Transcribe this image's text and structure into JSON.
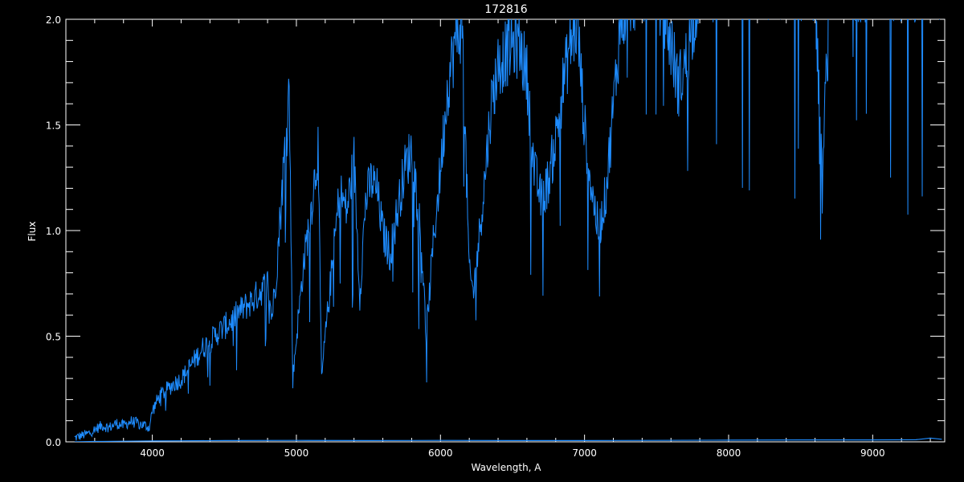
{
  "chart_data": {
    "type": "line",
    "title": "172816",
    "xlabel": "Wavelength, A",
    "ylabel": "Flux",
    "xlim": [
      3400,
      9500
    ],
    "ylim": [
      0.0,
      2.0
    ],
    "x_ticks": [
      "4000",
      "5000",
      "6000",
      "7000",
      "8000",
      "9000"
    ],
    "y_ticks": [
      "0.0",
      "0.5",
      "1.0",
      "1.5",
      "2.0"
    ],
    "grid": false,
    "colors": {
      "background": "#000000",
      "axes": "#ffffff",
      "spectrum": "#1e8cff",
      "error": "#1e8cff"
    },
    "series": [
      {
        "x": [
          3460,
          3500,
          3550,
          3600,
          3650,
          3700,
          3750,
          3800,
          3850,
          3900,
          3950,
          3980,
          4000,
          4050,
          4100,
          4150,
          4200,
          4250,
          4300,
          4350,
          4400,
          4450,
          4500,
          4550,
          4600,
          4650,
          4700,
          4750,
          4800,
          4830,
          4860,
          4900,
          4950,
          4975,
          5000,
          5050,
          5100,
          5150,
          5175,
          5200,
          5250,
          5300,
          5350,
          5400,
          5440,
          5480,
          5520,
          5560,
          5600,
          5650,
          5700,
          5750,
          5800,
          5850,
          5880,
          5900,
          5950,
          6000,
          6050,
          6100,
          6150,
          6200,
          6230,
          6250,
          6300,
          6350,
          6400,
          6450,
          6500,
          6550,
          6600,
          6650,
          6700,
          6750,
          6800,
          6850,
          6900,
          6950,
          7000,
          7050,
          7100,
          7150,
          7200,
          7250,
          7300,
          7400,
          7500,
          7600,
          7650,
          7700,
          7800,
          7900,
          8000,
          8200,
          8400,
          8600,
          8650,
          8700,
          8800,
          9000,
          9200,
          9400,
          9480
        ],
        "values": [
          0.02,
          0.03,
          0.04,
          0.06,
          0.08,
          0.07,
          0.09,
          0.08,
          0.1,
          0.09,
          0.08,
          0.07,
          0.15,
          0.22,
          0.25,
          0.28,
          0.3,
          0.35,
          0.4,
          0.45,
          0.48,
          0.52,
          0.55,
          0.58,
          0.62,
          0.65,
          0.68,
          0.72,
          0.76,
          0.6,
          0.8,
          1.2,
          1.7,
          0.3,
          0.5,
          0.85,
          1.1,
          1.4,
          0.3,
          0.5,
          0.85,
          1.2,
          1.1,
          1.35,
          0.7,
          1.15,
          1.25,
          1.2,
          1.0,
          0.9,
          1.1,
          1.3,
          1.4,
          1.1,
          0.8,
          0.5,
          0.95,
          1.3,
          1.7,
          1.9,
          2.0,
          0.8,
          0.72,
          0.85,
          1.2,
          1.6,
          1.8,
          1.85,
          1.9,
          1.9,
          1.75,
          1.3,
          1.15,
          1.25,
          1.45,
          1.7,
          1.9,
          2.0,
          1.5,
          1.2,
          1.0,
          1.2,
          1.6,
          2.0,
          2.1,
          2.2,
          2.2,
          1.9,
          1.7,
          1.8,
          2.2,
          2.2,
          2.2,
          2.2,
          2.2,
          2.2,
          1.2,
          2.2,
          2.2,
          2.2,
          2.2,
          2.2,
          2.2
        ]
      },
      {
        "x": [
          3460,
          3600,
          3800,
          4000,
          4200,
          4500,
          5000,
          5500,
          6000,
          6500,
          7000,
          7500,
          8000,
          8500,
          9000,
          9300,
          9400,
          9480
        ],
        "values": [
          0.0,
          0.002,
          0.003,
          0.004,
          0.005,
          0.006,
          0.007,
          0.006,
          0.007,
          0.006,
          0.006,
          0.007,
          0.008,
          0.009,
          0.009,
          0.01,
          0.018,
          0.012
        ]
      }
    ]
  }
}
